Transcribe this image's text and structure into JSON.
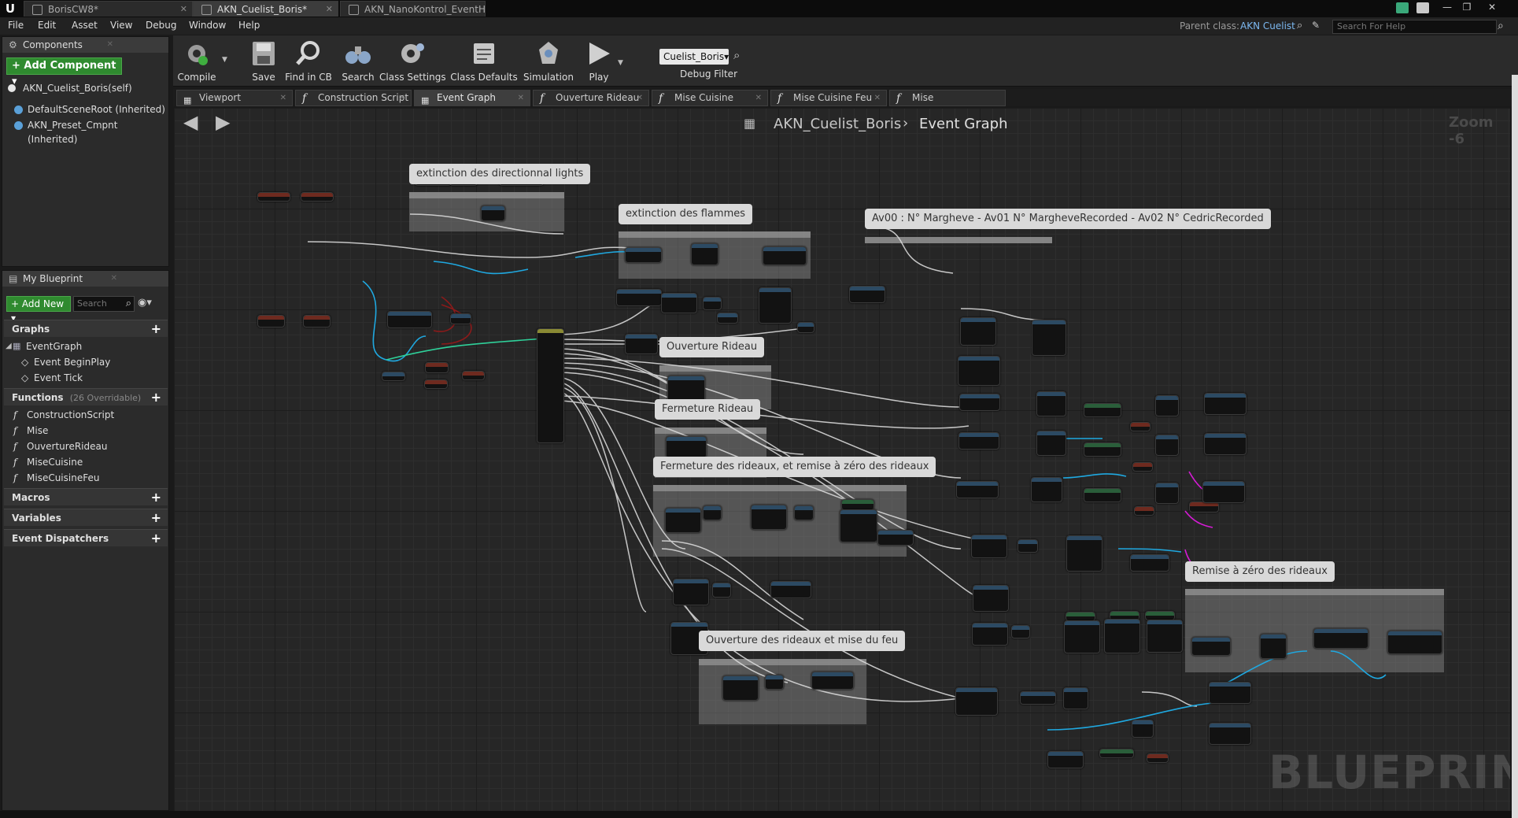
{
  "window": {
    "tabs": [
      {
        "label": "BorisCW8*"
      },
      {
        "label": "AKN_Cuelist_Boris*"
      },
      {
        "label": "AKN_NanoKontrol_EventH"
      }
    ]
  },
  "menu": {
    "items": [
      "File",
      "Edit",
      "Asset",
      "View",
      "Debug",
      "Window",
      "Help"
    ],
    "parent_class_label": "Parent class:",
    "parent_class_value": "AKN Cuelist",
    "help_search_placeholder": "Search For Help"
  },
  "components_panel": {
    "tab_label": "Components",
    "add_button_label": "+ Add Component ▾",
    "root_item": "AKN_Cuelist_Boris(self)",
    "items": [
      "DefaultSceneRoot (Inherited)",
      "AKN_Preset_Cmpnt (Inherited)"
    ]
  },
  "my_blueprint_panel": {
    "tab_label": "My Blueprint",
    "add_new_label": "+ Add New ▾",
    "search_placeholder": "Search",
    "graphs_header": "Graphs",
    "event_graph": "EventGraph",
    "events": [
      "Event BeginPlay",
      "Event Tick"
    ],
    "functions_header": "Functions",
    "functions_override": "(26 Overridable)",
    "functions": [
      "ConstructionScript",
      "Mise",
      "OuvertureRideau",
      "MiseCuisine",
      "MiseCuisineFeu"
    ],
    "macros_header": "Macros",
    "variables_header": "Variables",
    "dispatchers_header": "Event Dispatchers"
  },
  "toolbar": {
    "compile": "Compile",
    "save": "Save",
    "find_in_cb": "Find in CB",
    "search": "Search",
    "class_settings": "Class Settings",
    "class_defaults": "Class Defaults",
    "simulation": "Simulation",
    "play": "Play",
    "debug_filter_value": "Cuelist_Boris▾",
    "debug_filter_label": "Debug Filter"
  },
  "graph_tabs": [
    {
      "label": "Viewport",
      "icon": "viewport-icon"
    },
    {
      "label": "Construction Script",
      "icon": "function-icon"
    },
    {
      "label": "Event Graph",
      "icon": "graph-icon"
    },
    {
      "label": "Ouverture Rideau",
      "icon": "function-icon"
    },
    {
      "label": "Mise Cuisine",
      "icon": "function-icon"
    },
    {
      "label": "Mise Cuisine Feu",
      "icon": "function-icon"
    },
    {
      "label": "Mise",
      "icon": "function-icon"
    }
  ],
  "graph": {
    "breadcrumb_blueprint": "AKN_Cuelist_Boris",
    "breadcrumb_graph": "Event Graph",
    "zoom": "Zoom -6",
    "watermark": "BLUEPRINT",
    "comments": [
      "extinction des directionnal lights",
      "extinction des flammes",
      "Av00 : N° Margheve  -  Av01 N° MargheveRecorded  -  Av02 N° CedricRecorded",
      "Ouverture  Rideau",
      "Fermeture Rideau",
      "Fermeture des rideaux, et remise à zéro des rideaux",
      "Remise à zéro des rideaux",
      "Ouverture des rideaux et mise du feu"
    ]
  },
  "colors": {
    "exec_wire": "#d8d8d8",
    "data_wire_blue": "#1fa8e0",
    "data_wire_green": "#2fd19a",
    "bool_wire_red": "#8b1a1a",
    "magenta_wire": "#d51bd5",
    "accent_blue": "#7cb8f0",
    "add_green": "#2f8a2f"
  }
}
